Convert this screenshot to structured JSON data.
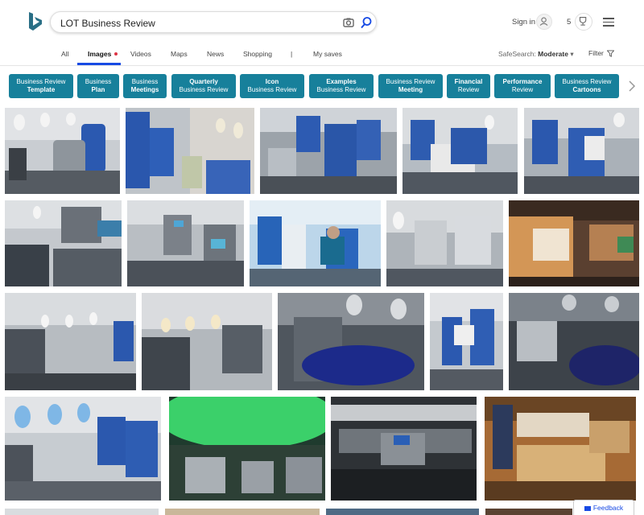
{
  "search": {
    "query": "LOT Business Review"
  },
  "header": {
    "signin_label": "Sign in",
    "rewards_count": "5"
  },
  "nav": {
    "tabs": [
      {
        "label": "All"
      },
      {
        "label": "Images"
      },
      {
        "label": "Videos"
      },
      {
        "label": "Maps"
      },
      {
        "label": "News"
      },
      {
        "label": "Shopping"
      },
      {
        "label": "|"
      },
      {
        "label": "My saves"
      }
    ],
    "active_tab": "Images",
    "safesearch_label": "SafeSearch:",
    "safesearch_value": "Moderate",
    "filter_label": "Filter"
  },
  "chips": [
    {
      "line1": "Business Review",
      "line2": "Template",
      "bold_line": 2
    },
    {
      "line1": "Business",
      "line2": "Plan",
      "bold_line": 2
    },
    {
      "line1": "Business",
      "line2": "Meetings",
      "bold_line": 2
    },
    {
      "line1": "Quarterly",
      "line2": "Business Review",
      "bold_line": 1
    },
    {
      "line1": "Icon",
      "line2": "Business Review",
      "bold_line": 1
    },
    {
      "line1": "Examples",
      "line2": "Business Review",
      "bold_line": 1
    },
    {
      "line1": "Business Review",
      "line2": "Meeting",
      "bold_line": 2
    },
    {
      "line1": "Financial",
      "line2": "Review",
      "bold_line": 1
    },
    {
      "line1": "Performance",
      "line2": "Review",
      "bold_line": 1
    },
    {
      "line1": "Business Review",
      "line2": "Cartoons",
      "bold_line": 2
    }
  ],
  "feedback_label": "Feedback",
  "colors": {
    "accent": "#174ae4",
    "chip": "#17809b",
    "seat_blue": "#1f4fa8"
  }
}
